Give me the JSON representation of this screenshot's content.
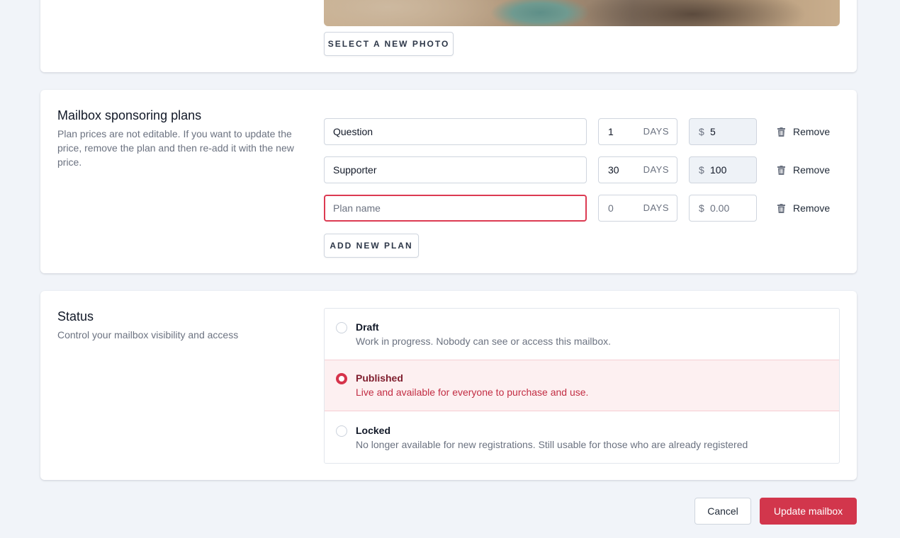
{
  "photo_section": {
    "select_photo_label": "SELECT A NEW PHOTO"
  },
  "plans_section": {
    "title": "Mailbox sponsoring plans",
    "description": "Plan prices are not editable. If you want to update the price, remove the plan and then re-add it with the new price.",
    "days_unit": "DAYS",
    "currency": "$",
    "remove_label": "Remove",
    "plans": [
      {
        "name": "Question",
        "days": "1",
        "price": "5",
        "price_editable": false
      },
      {
        "name": "Supporter",
        "days": "30",
        "price": "100",
        "price_editable": false
      }
    ],
    "new_plan": {
      "name_placeholder": "Plan name",
      "days_placeholder": "0",
      "price_placeholder": "0.00"
    },
    "add_plan_label": "ADD NEW PLAN"
  },
  "status_section": {
    "title": "Status",
    "description": "Control your mailbox visibility and access",
    "options": [
      {
        "title": "Draft",
        "description": "Work in progress. Nobody can see or access this mailbox.",
        "selected": false
      },
      {
        "title": "Published",
        "description": "Live and available for everyone to purchase and use.",
        "selected": true
      },
      {
        "title": "Locked",
        "description": "No longer available for new registrations. Still usable for those who are already registered",
        "selected": false
      }
    ]
  },
  "footer": {
    "cancel_label": "Cancel",
    "update_label": "Update mailbox"
  },
  "colors": {
    "accent": "#d2364c",
    "page_background": "#f1f4f9",
    "selected_background": "#fdf0f1"
  },
  "icons": {
    "remove": "trash-icon"
  }
}
